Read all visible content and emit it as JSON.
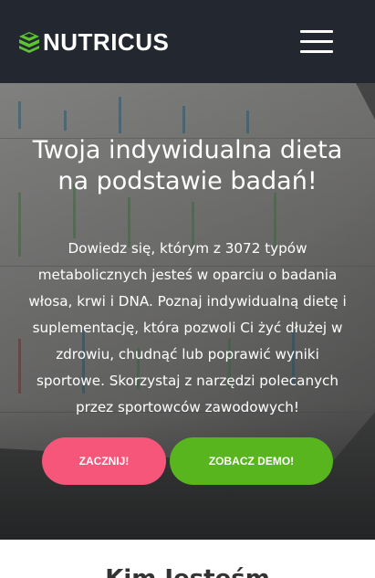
{
  "header": {
    "brand": "NUTRICUS",
    "menu_icon": "hamburger-icon",
    "logo_icon": "layers-logo-icon",
    "colors": {
      "background": "#23272f",
      "logo_accent": "#5cc430"
    }
  },
  "hero": {
    "title_line1": "Twoja indywidualna dieta",
    "title_line2": "na podstawie badań!",
    "description": "Dowiedz się, którym z 3072 typów metabolicznych jesteś w oparciu o badania włosa, krwi i DNA. Poznaj indywidualną dietę i suplementację, która pozwoli Ci żyć dłużej w zdrowiu, chudnąć lub poprawić wyniki sportowe. Skorzystaj z narzędzi polecanych przez sportowców zawodowych!",
    "buttons": {
      "start_label": "ZACZNIJ!",
      "demo_label": "ZOBACZ DEMO!"
    },
    "colors": {
      "start": "#f5567a",
      "demo": "#58b51e"
    }
  },
  "next_section": {
    "heading": "Kim Jesteśm"
  }
}
